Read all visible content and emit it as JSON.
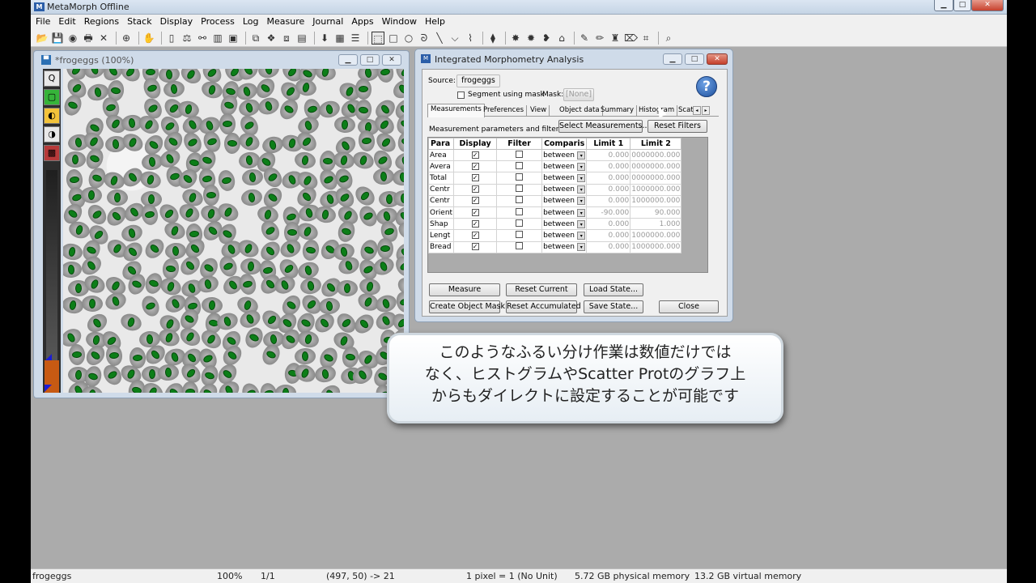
{
  "app": {
    "title": "MetaMorph Offline",
    "icon_letter": "M"
  },
  "window_controls": {
    "min": "▁",
    "max": "□",
    "close": "✕"
  },
  "menubar": [
    "File",
    "Edit",
    "Regions",
    "Stack",
    "Display",
    "Process",
    "Log",
    "Measure",
    "Journal",
    "Apps",
    "Window",
    "Help"
  ],
  "toolbar_icons": [
    "open-folder-icon",
    "save-icon",
    "color-icon",
    "print-icon",
    "close-icon",
    "sep",
    "target-icon",
    "sep",
    "grab-icon",
    "sep",
    "stack-icon",
    "scale-icon",
    "binoculars-icon",
    "histogram-icon",
    "display-icon",
    "sep",
    "layers-icon",
    "regions-icon",
    "multi-region-icon",
    "grid-icon",
    "sep",
    "arrow-tool-icon",
    "regions-list-icon",
    "list-icon",
    "sep",
    "select-arrow-icon",
    "rectangle-icon",
    "ellipse-icon",
    "freehand-icon",
    "line-icon",
    "polyline-icon",
    "trace-icon",
    "sep",
    "overlay-icon",
    "sep",
    "marker-icon",
    "stamp-icon",
    "pin-icon",
    "stack-edit-icon",
    "sep",
    "pen-icon",
    "pencil-icon",
    "paint-icon",
    "eraser-icon",
    "copy-icon",
    "sep",
    "zoom-region-icon"
  ],
  "toolbar_glyphs": [
    "📂",
    "💾",
    "◉",
    "🖶",
    "✕",
    "",
    "⊕",
    "",
    "✋",
    "",
    "▯",
    "⚖",
    "⚯",
    "▥",
    "▣",
    "",
    "⧉",
    "❖",
    "⧈",
    "▤",
    "",
    "⬇",
    "▦",
    "☰",
    "",
    "⬚",
    "□",
    "○",
    "ᘐ",
    "╲",
    "⌵",
    "⌇",
    "",
    "⧫",
    "",
    "✸",
    "✹",
    "❥",
    "⌂",
    "",
    "✎",
    "✏",
    "♜",
    "⌦",
    "⌗",
    "",
    "⌕"
  ],
  "image_window": {
    "title": "*frogeggs (100%)",
    "tools": [
      "Q",
      "▢",
      "◐",
      "◑",
      "▩"
    ],
    "controls": {
      "min": "▁",
      "max": "□",
      "close": "✕"
    }
  },
  "dialog": {
    "title": "Integrated Morphometry Analysis",
    "source_label": "Source:",
    "source_value": "frogeggs",
    "segment_label": "Segment using mask",
    "mask_label": "Mask:",
    "mask_value": "[None]",
    "help": "?",
    "tabs": [
      "Measurements",
      "Preferences",
      "View",
      "Object data",
      "Summary",
      "Histogram",
      "Scat"
    ],
    "tab_arrows": [
      "◂",
      "▸"
    ],
    "params_label": "Measurement parameters and filters:",
    "select_btn": "Select Measurements...",
    "reset_filters_btn": "Reset Filters",
    "columns": [
      "Para",
      "Display",
      "Filter",
      "Comparis",
      "Limit 1",
      "Limit 2"
    ],
    "rows": [
      {
        "param": "Area",
        "display": "✓",
        "filter": "",
        "comp": "between",
        "l1": "0.000",
        "l2": "0000000.000"
      },
      {
        "param": "Avera",
        "display": "✓",
        "filter": "",
        "comp": "between",
        "l1": "0.000",
        "l2": "0000000.000"
      },
      {
        "param": "Total",
        "display": "✓",
        "filter": "",
        "comp": "between",
        "l1": "0.000",
        "l2": "0000000.000"
      },
      {
        "param": "Centr",
        "display": "✓",
        "filter": "",
        "comp": "between",
        "l1": "0.000",
        "l2": "1000000.000"
      },
      {
        "param": "Centr",
        "display": "✓",
        "filter": "",
        "comp": "between",
        "l1": "0.000",
        "l2": "1000000.000"
      },
      {
        "param": "Orient",
        "display": "✓",
        "filter": "",
        "comp": "between",
        "l1": "-90.000",
        "l2": "90.000"
      },
      {
        "param": "Shap",
        "display": "✓",
        "filter": "",
        "comp": "between",
        "l1": "0.000",
        "l2": "1.000"
      },
      {
        "param": "Lengt",
        "display": "✓",
        "filter": "",
        "comp": "between",
        "l1": "0.000",
        "l2": "1000000.000"
      },
      {
        "param": "Bread",
        "display": "✓",
        "filter": "",
        "comp": "between",
        "l1": "0.000",
        "l2": "1000000.000"
      }
    ],
    "dropdown_arrow": "▾",
    "buttons": {
      "measure": "Measure",
      "reset_current": "Reset Current",
      "load_state": "Load State...",
      "create_mask": "Create Object Mask",
      "reset_accumulated": "Reset Accumulated",
      "save_state": "Save State...",
      "close": "Close"
    },
    "controls": {
      "min": "▁",
      "max": "□",
      "close": "✕"
    }
  },
  "caption": {
    "line1": "このようなふるい分け作業は数値だけでは",
    "line2": "なく、ヒストグラムやScatter Protのグラフ上",
    "line3": "からもダイレクトに設定することが可能です"
  },
  "status": {
    "image": "frogeggs",
    "zoom": "100%",
    "plane": "1/1",
    "coords": "(497, 50) -> 21",
    "calibration": "1 pixel = 1 (No Unit)",
    "physical": "5.72 GB physical memory",
    "virtual": "13.2 GB virtual memory"
  },
  "colors": {
    "nucleus": "#0c7e18",
    "desktop": "#abababff",
    "accent_close": "#c5402c",
    "lut_marker": "#c75a13"
  }
}
